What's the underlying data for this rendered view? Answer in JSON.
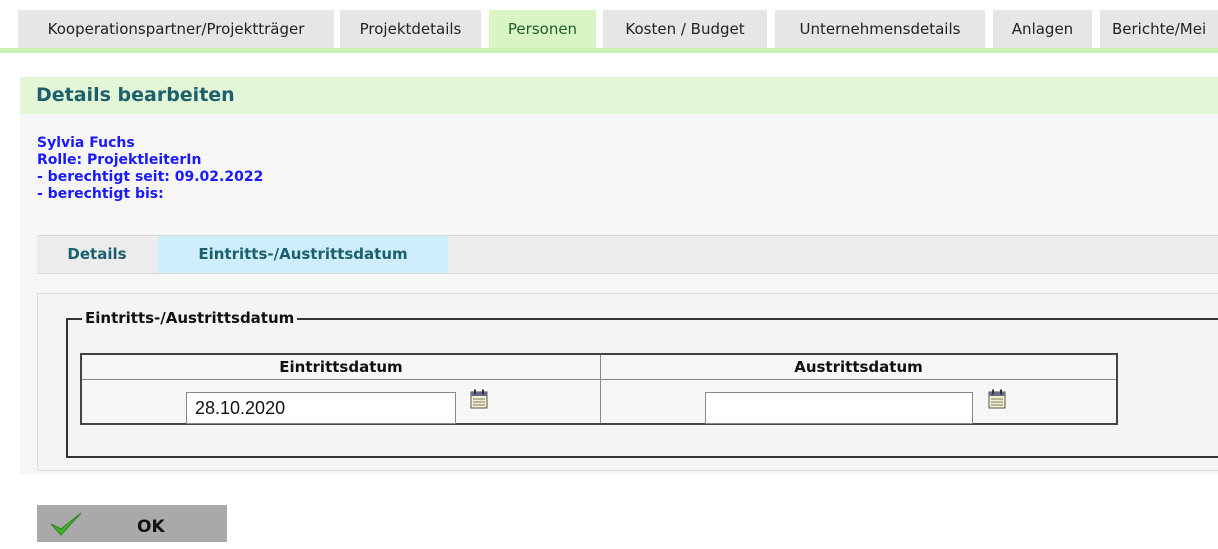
{
  "topnav": {
    "tabs": [
      {
        "label": "Kooperationspartner/Projektträger"
      },
      {
        "label": "Projektdetails"
      },
      {
        "label": "Personen"
      },
      {
        "label": "Kosten / Budget"
      },
      {
        "label": "Unternehmensdetails"
      },
      {
        "label": "Anlagen"
      },
      {
        "label": "Berichte/Mei"
      }
    ],
    "active_index": 2
  },
  "panel": {
    "title": "Details bearbeiten"
  },
  "person": {
    "name": "Sylvia Fuchs",
    "role": "Rolle: ProjektleiterIn",
    "since": "- berechtigt seit: 09.02.2022",
    "until": "- berechtigt bis:"
  },
  "subtabs": [
    {
      "label": "Details"
    },
    {
      "label": "Eintritts-/Austrittsdatum"
    }
  ],
  "fieldset": {
    "legend": "Eintritts-/Austrittsdatum"
  },
  "dates": {
    "entry_header": "Eintrittsdatum",
    "exit_header": "Austrittsdatum",
    "entry_value": "28.10.2020",
    "exit_value": ""
  },
  "ok_button": {
    "label": "OK"
  },
  "colors": {
    "active_tab": "#d9f5c4",
    "header_bg": "#e3f7d6",
    "title_text": "#1c5f6d",
    "person_text": "#1a1aff",
    "active_subtab": "#cdeefa",
    "ok_button_bg": "#a9a9a9",
    "check_green": "#3fb42a"
  },
  "icons": [
    "calendar-icon",
    "checkmark-icon"
  ]
}
